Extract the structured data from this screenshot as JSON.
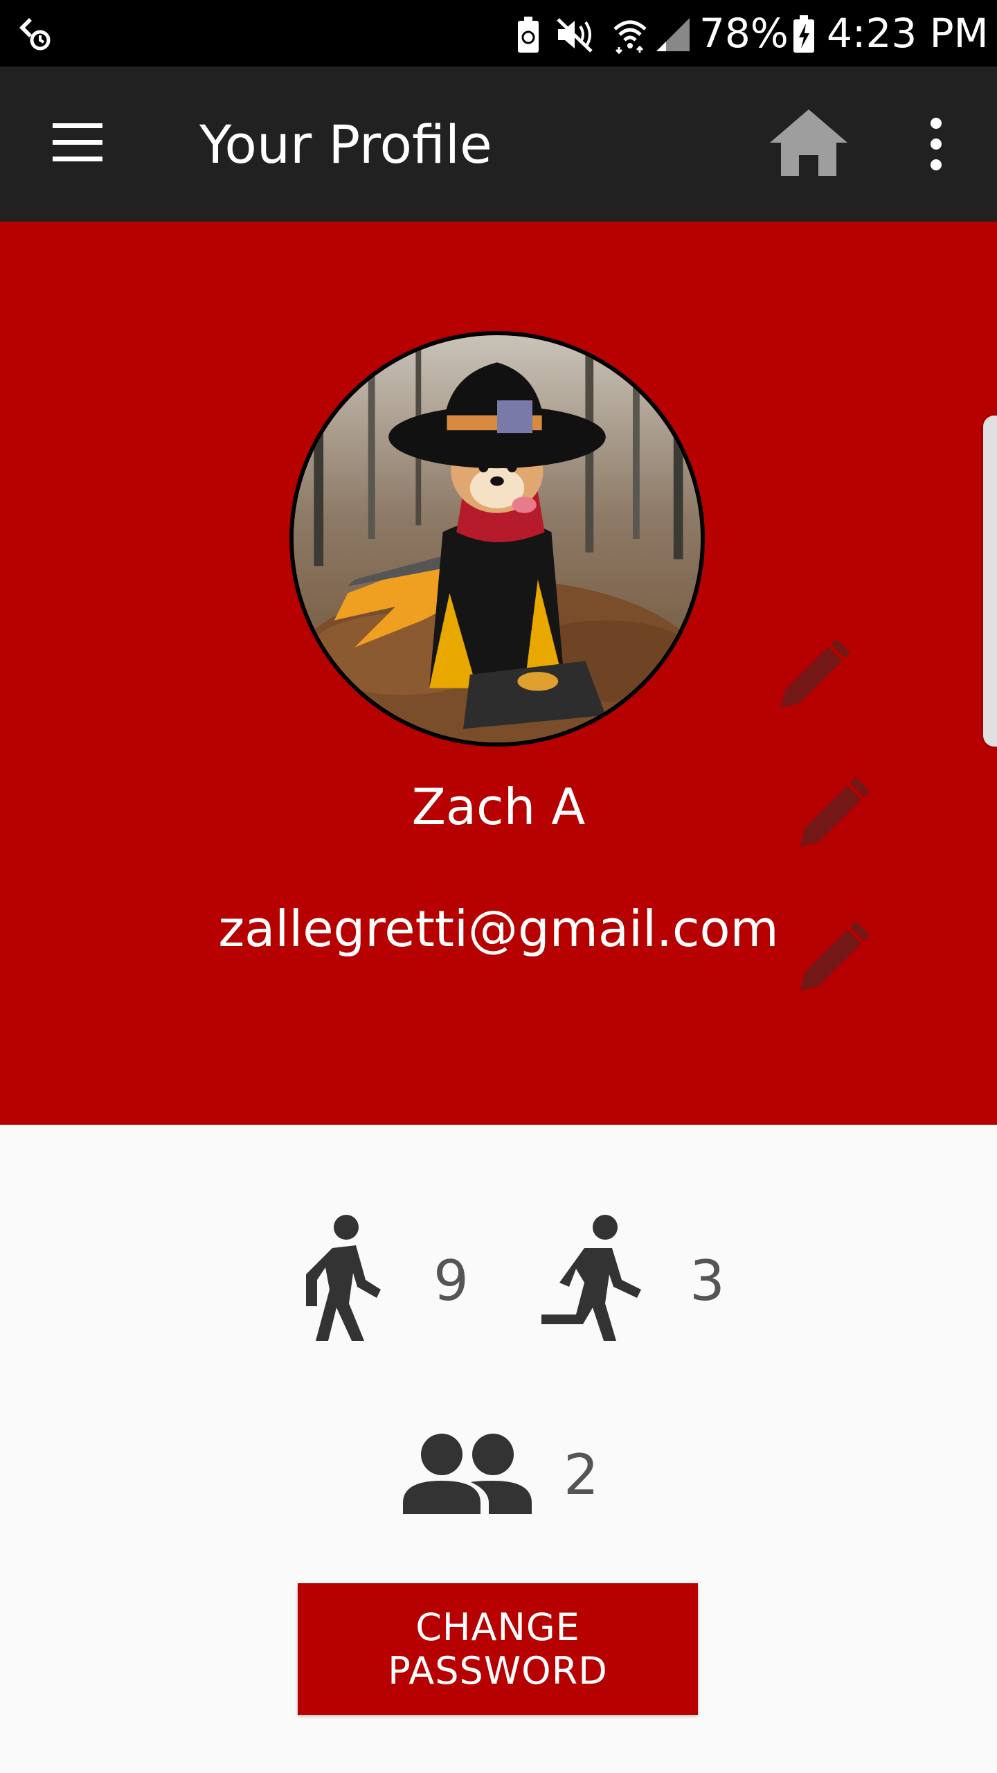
{
  "status_bar": {
    "battery_percent": "78%",
    "time": "4:23 PM",
    "icons": [
      "sync-icon",
      "battery-saver-icon",
      "mute-icon",
      "wifi-icon",
      "signal-icon",
      "battery-charging-icon"
    ]
  },
  "app_bar": {
    "title": "Your Profile",
    "menu_icon": "hamburger-menu-icon",
    "home_icon": "home-icon",
    "more_icon": "more-vert-icon"
  },
  "profile": {
    "name": "Zach A",
    "email": "zallegretti@gmail.com",
    "avatar_description_icon": "avatar-image",
    "edit_icons": [
      "edit-avatar-icon",
      "edit-name-icon",
      "edit-email-icon"
    ]
  },
  "stats": {
    "walking_count": "9",
    "running_count": "3",
    "friends_count": "2"
  },
  "actions": {
    "change_password_label": "CHANGE PASSWORD"
  },
  "colors": {
    "primary_red": "#b70000",
    "app_bar": "#212121",
    "status_bar": "#000000",
    "background": "#fafafa",
    "stat_text": "#555555",
    "edit_icon": "#6b1a1a"
  }
}
